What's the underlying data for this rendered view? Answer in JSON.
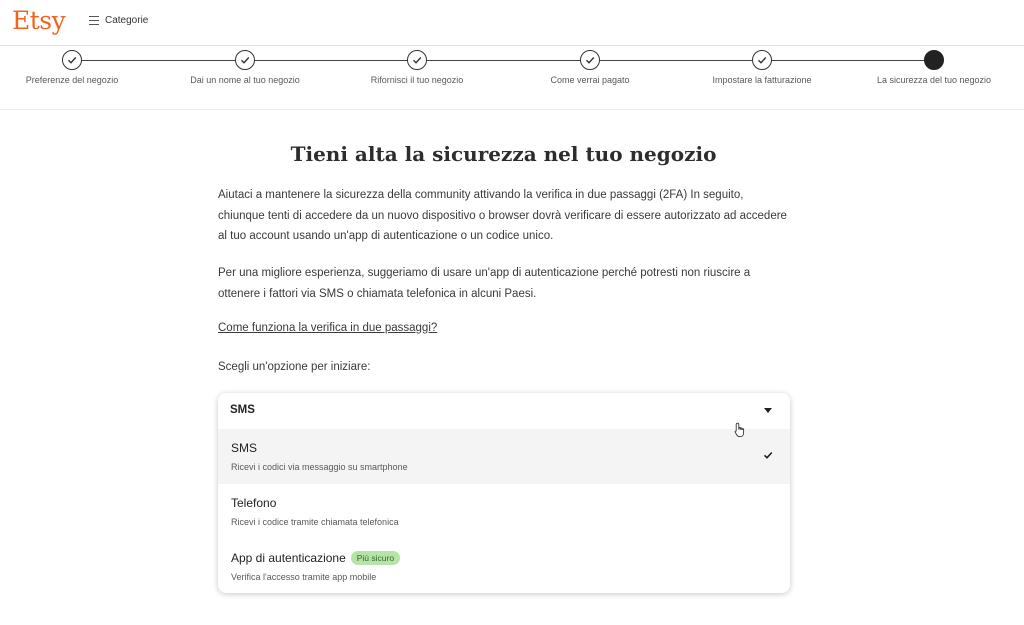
{
  "header": {
    "logo": "Etsy",
    "categories_label": "Categorie"
  },
  "steps": [
    {
      "label": "Preferenze del negozio",
      "status": "done"
    },
    {
      "label": "Dai un nome al tuo negozio",
      "status": "done"
    },
    {
      "label": "Rifornisci il tuo negozio",
      "status": "done"
    },
    {
      "label": "Come verrai pagato",
      "status": "done"
    },
    {
      "label": "Impostare la fatturazione",
      "status": "done"
    },
    {
      "label": "La sicurezza del tuo negozio",
      "status": "current"
    }
  ],
  "main": {
    "title": "Tieni alta la sicurezza nel tuo negozio",
    "paragraph1": "Aiutaci a mantenere la sicurezza della community attivando la verifica in due passaggi (2FA) In seguito, chiunque tenti di accedere da un nuovo dispositivo o browser dovrà verificare di essere autorizzato ad accedere al tuo account usando un'app di autenticazione o un codice unico.",
    "paragraph2": "Per una migliore esperienza, suggeriamo di usare un'app di autenticazione perché potresti non riuscire a ottenere i fattori via SMS o chiamata telefonica in alcuni Paesi.",
    "help_link": "Come funziona la verifica in due passaggi?",
    "prompt": "Scegli un'opzione per iniziare:"
  },
  "dropdown": {
    "selected": "SMS",
    "options": [
      {
        "label": "SMS",
        "description": "Ricevi i codici via messaggio su smartphone",
        "selected": true
      },
      {
        "label": "Telefono",
        "description": "Ricevi i codice tramite chiamata telefonica",
        "selected": false
      },
      {
        "label": "App di autenticazione",
        "badge": "Più sicuro",
        "description": "Verifica l'accesso tramite app mobile",
        "selected": false
      }
    ]
  },
  "colors": {
    "brand": "#f1641e",
    "badge_bg": "#b5e3a8",
    "badge_text": "#2e6b2a",
    "selected_row": "#f4f4f4"
  },
  "icons": [
    "hamburger-icon",
    "check-icon",
    "caret-down-icon",
    "hand-cursor-icon"
  ]
}
